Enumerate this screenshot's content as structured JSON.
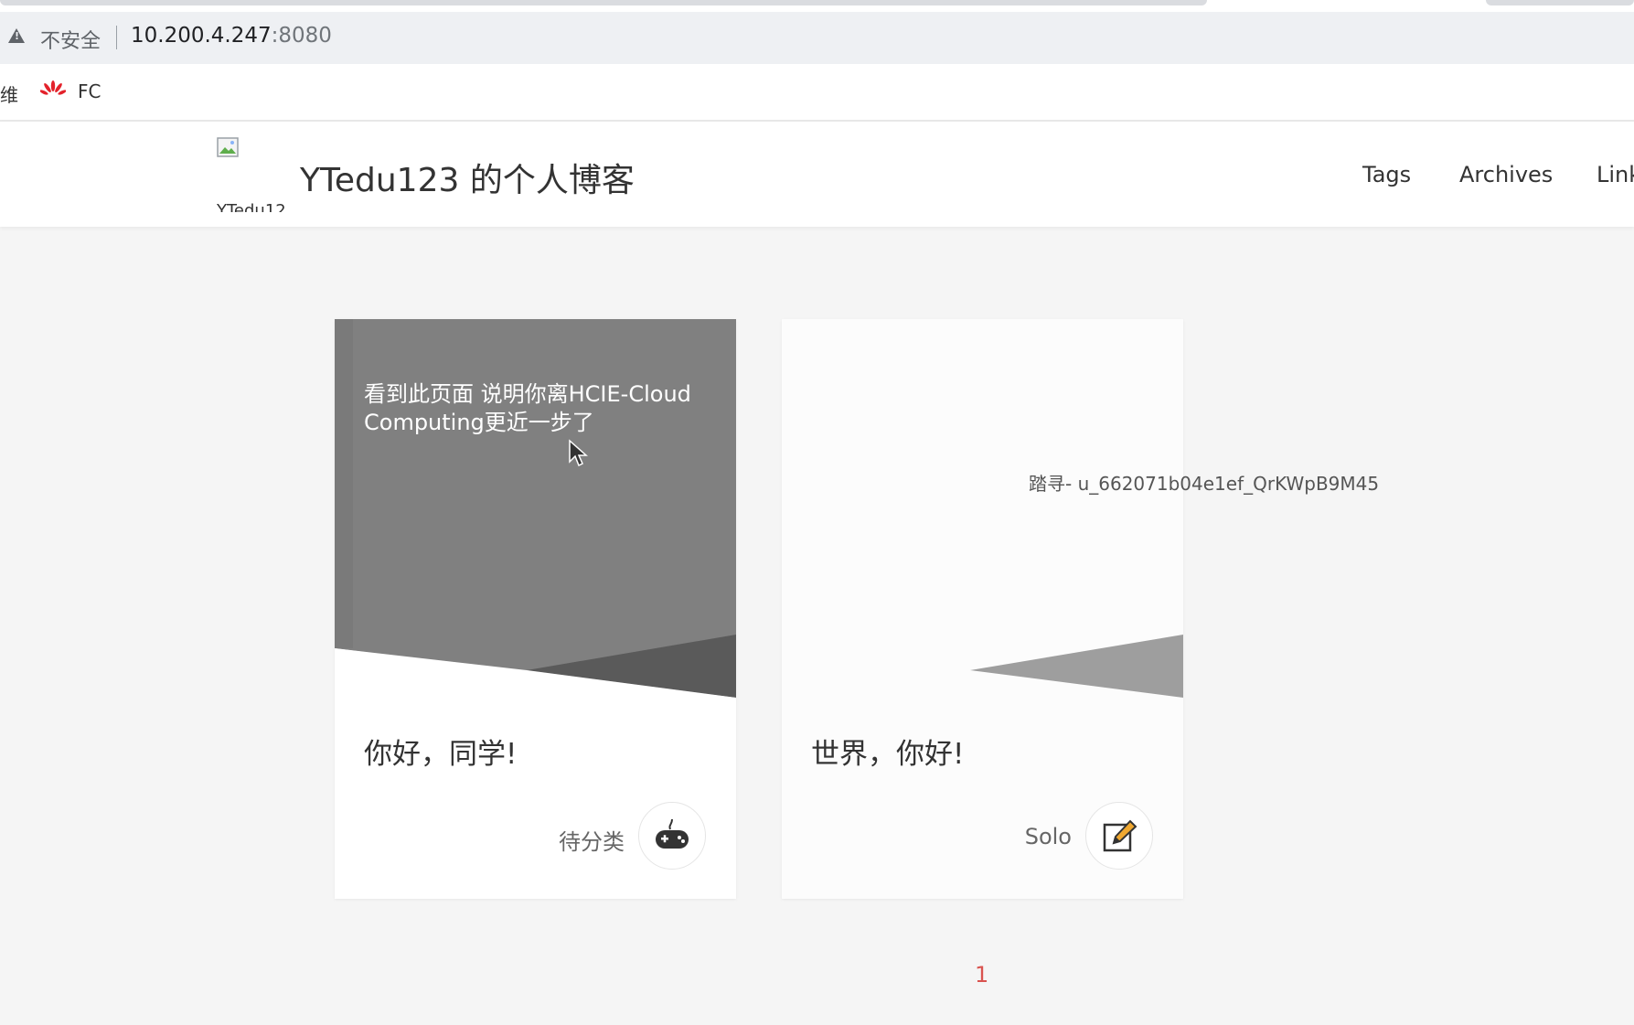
{
  "browser": {
    "security_label": "不安全",
    "url_host": "10.200.4.247",
    "url_port": ":8080",
    "bookmarks": [
      {
        "label": "维",
        "icon": "truncated-bookmark"
      },
      {
        "label": "FC",
        "icon": "huawei-logo-icon"
      }
    ]
  },
  "site": {
    "logo_alt": "YTedu12",
    "title": "YTedu123 的个人博客",
    "nav": [
      "Tags",
      "Archives",
      "Link"
    ]
  },
  "posts": [
    {
      "excerpt": "看到此页面 说明你离HCIE-Cloud Computing更近一步了",
      "title": "你好，同学!",
      "category": "待分类",
      "category_icon": "gamepad-icon"
    },
    {
      "excerpt": "",
      "title": "世界，你好!",
      "category": "Solo",
      "category_icon": "edit-icon"
    }
  ],
  "watermark": "踏寻- u_662071b04e1ef_QrKWpB9M45",
  "pagination": {
    "current": "1"
  },
  "colors": {
    "accent": "#d9534f",
    "cover_gray": "#808080",
    "background": "#f5f5f5"
  }
}
